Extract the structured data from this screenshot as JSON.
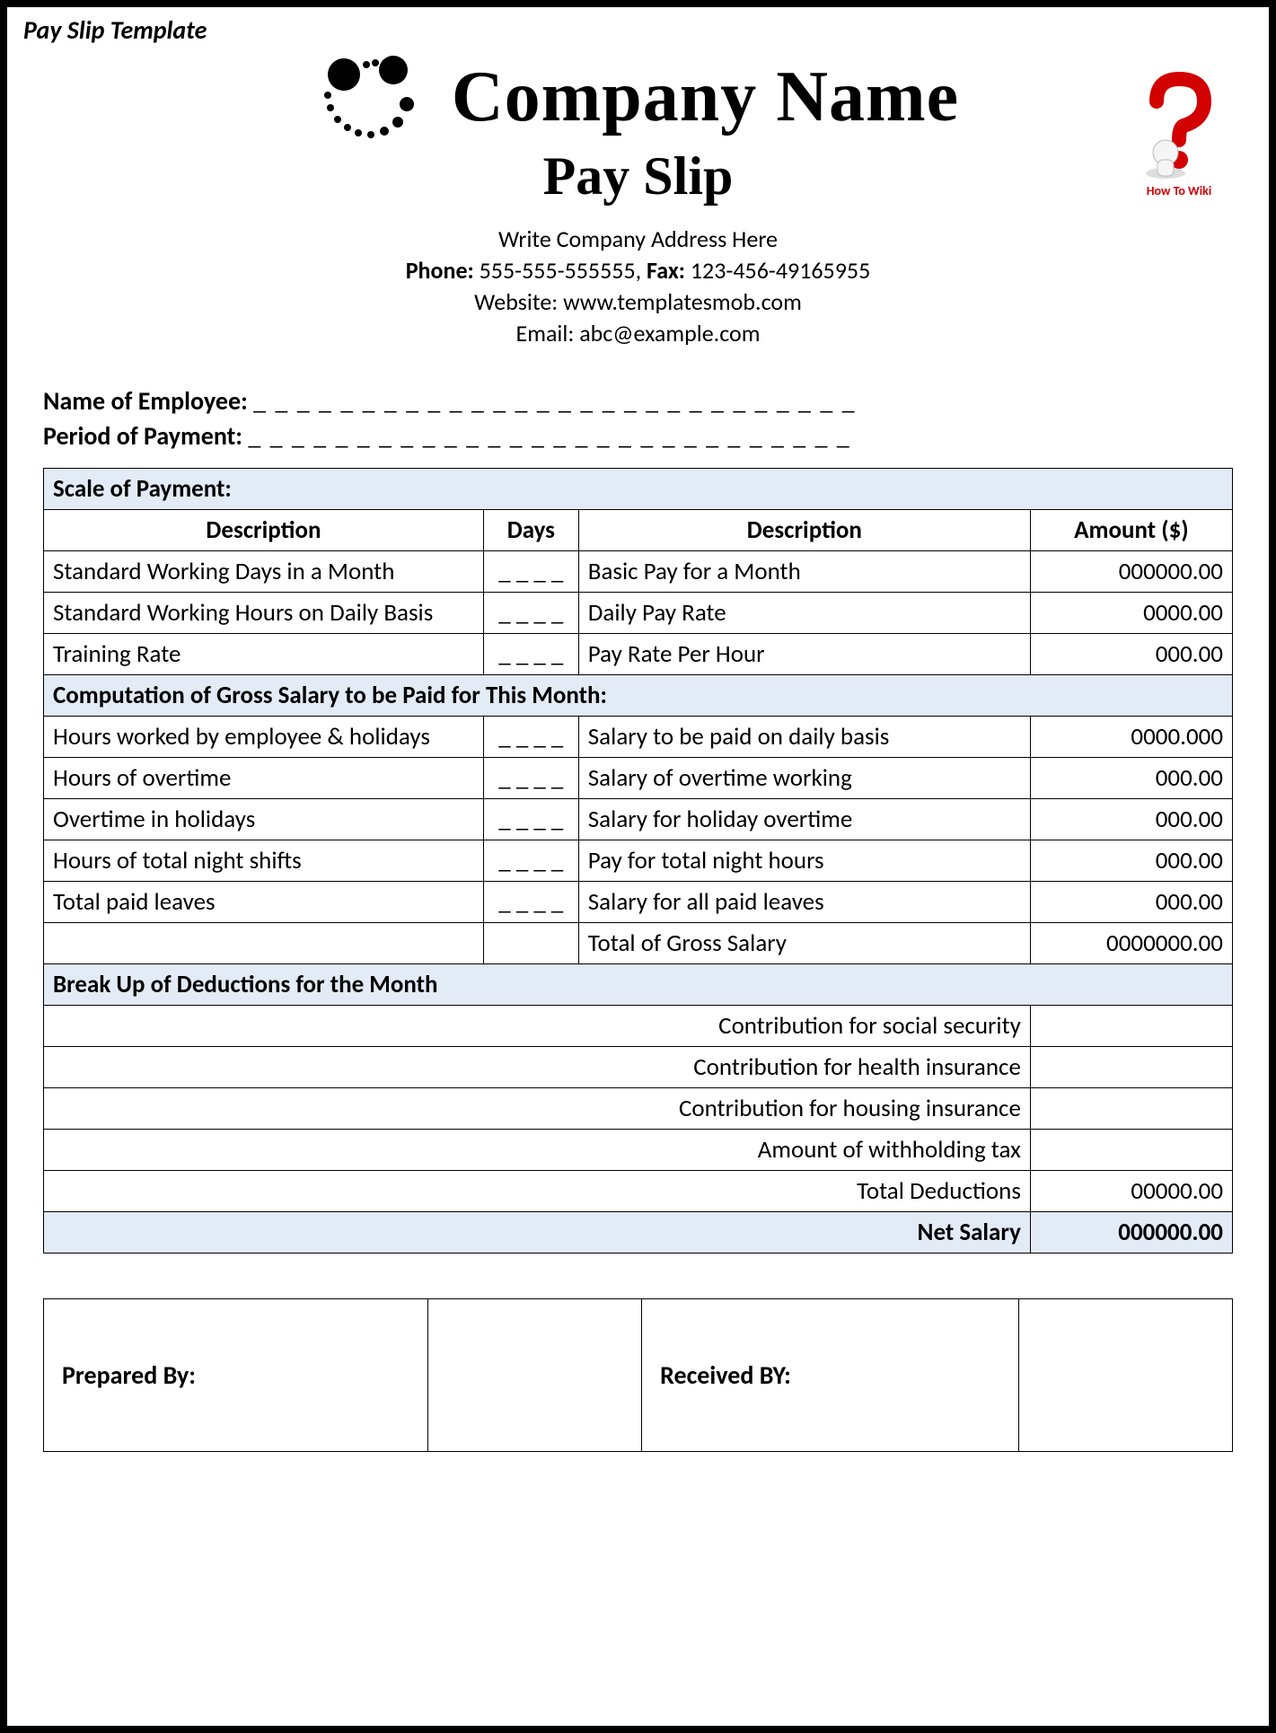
{
  "template_label": "Pay Slip Template",
  "header": {
    "company_name": "Company Name",
    "title": "Pay Slip",
    "address": "Write Company Address Here",
    "phone_label": "Phone:",
    "phone": "555-555-555555,",
    "fax_label": "Fax:",
    "fax": "123-456-49165955",
    "website": "Website: www.templatesmob.com",
    "email": "Email: abc@example.com",
    "watermark": "How To Wiki"
  },
  "employee": {
    "name_label": "Name of Employee:",
    "period_label": "Period of Payment:",
    "blank_line": "_ _ _ _ _ _ _ _ _ _ _ _ _ _ _ _ _ _ _ _ _ _ _ _ _ _ _ _"
  },
  "section_scale": "Scale of Payment:",
  "cols_left": {
    "desc": "Description",
    "days": "Days"
  },
  "cols_right": {
    "desc": "Description",
    "amt": "Amount ($)"
  },
  "scale_rows": [
    {
      "l": "Standard Working Days in a Month",
      "d": "_ _ _ _",
      "r": "Basic Pay for a Month",
      "a": "000000.00"
    },
    {
      "l": "Standard Working Hours on Daily Basis",
      "d": "_ _ _ _",
      "r": "Daily Pay Rate",
      "a": "0000.00"
    },
    {
      "l": "Training Rate",
      "d": "_ _ _ _",
      "r": "Pay Rate Per Hour",
      "a": "000.00"
    }
  ],
  "section_gross": "Computation of Gross Salary to be Paid for This Month:",
  "gross_rows": [
    {
      "l": "Hours worked by employee & holidays",
      "d": "_ _ _ _",
      "r": "Salary to be paid on daily basis",
      "a": "0000.000"
    },
    {
      "l": "Hours of overtime",
      "d": "_ _ _ _",
      "r": "Salary of overtime working",
      "a": "000.00"
    },
    {
      "l": "Overtime in holidays",
      "d": "_ _ _ _",
      "r": "Salary for holiday overtime",
      "a": "000.00"
    },
    {
      "l": "Hours of total night shifts",
      "d": "_ _ _ _",
      "r": "Pay for total night hours",
      "a": "000.00"
    },
    {
      "l": "Total paid leaves",
      "d": "_ _ _ _",
      "r": "Salary for all paid leaves",
      "a": "000.00"
    }
  ],
  "gross_total": {
    "label": "Total of Gross Salary",
    "amount": "0000000.00"
  },
  "section_deductions": "Break Up of Deductions for the Month",
  "deduction_rows": [
    "Contribution for social security",
    "Contribution for health insurance",
    "Contribution for housing insurance",
    "Amount of withholding tax"
  ],
  "deduction_total": {
    "label": "Total Deductions",
    "amount": "00000.00"
  },
  "net": {
    "label": "Net Salary",
    "amount": "000000.00"
  },
  "signatures": {
    "prepared": "Prepared By:",
    "received": "Received BY:"
  }
}
